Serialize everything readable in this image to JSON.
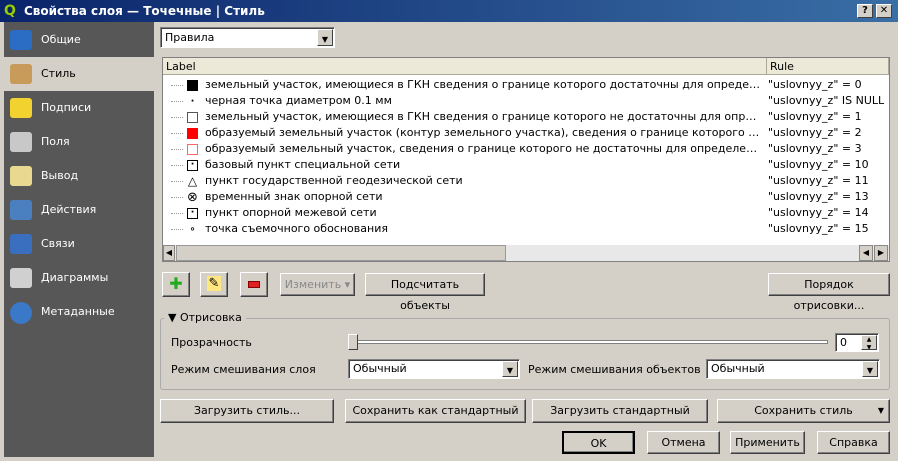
{
  "window": {
    "title": "Свойства слоя — Точечные | Стиль",
    "help_btn": "?",
    "close_btn": "✕"
  },
  "sidebar": {
    "items": [
      {
        "label": "Общие",
        "icon": "tools-icon",
        "color": "#2b6cc4"
      },
      {
        "label": "Стиль",
        "icon": "paintbrush-icon",
        "color": "#c89b5a"
      },
      {
        "label": "Подписи",
        "icon": "abc-label-icon",
        "color": "#f2d22e"
      },
      {
        "label": "Поля",
        "icon": "table-icon",
        "color": "#c8c8c8"
      },
      {
        "label": "Вывод",
        "icon": "speech-bubble-icon",
        "color": "#e8d890"
      },
      {
        "label": "Действия",
        "icon": "gear-play-icon",
        "color": "#4a7fc0"
      },
      {
        "label": "Связи",
        "icon": "arrow-left-icon",
        "color": "#3a6fc0"
      },
      {
        "label": "Диаграммы",
        "icon": "chart-icon",
        "color": "#d0d0d0"
      },
      {
        "label": "Метаданные",
        "icon": "info-icon",
        "color": "#3a78c8"
      }
    ],
    "selected": 1
  },
  "renderer": {
    "value": "Правила"
  },
  "tree": {
    "headers": [
      "Label",
      "Rule"
    ],
    "rows": [
      {
        "symbol": "filled-square",
        "color": "#000000",
        "label": "земельный участок, имеющиеся в ГКН сведения о границе которого достаточны для определения ее пол...",
        "rule": "\"uslovnyy_z\" = 0"
      },
      {
        "symbol": "dot",
        "color": "#000000",
        "label": "черная точка диаметром 0.1 мм",
        "rule": "\"uslovnyy_z\" IS NULL"
      },
      {
        "symbol": "empty-square",
        "color": "#000000",
        "label": "земельный участок, имеющиеся в ГКН сведения о границе которого не достаточны для определения ее п...",
        "rule": "\"uslovnyy_z\" = 1"
      },
      {
        "symbol": "filled-square",
        "color": "#ff0000",
        "label": "образуемый земельный участок (контур земельного участка), сведения о границе которого достаточны ...",
        "rule": "\"uslovnyy_z\" = 2"
      },
      {
        "symbol": "empty-square",
        "color": "#ff0000",
        "label": "образуемый земельный участок, сведения о границе которого не достаточны для определения ее полож...",
        "rule": "\"uslovnyy_z\" = 3"
      },
      {
        "symbol": "square-dot",
        "color": "#000000",
        "label": "базовый пункт специальной сети",
        "rule": "\"uslovnyy_z\" = 10"
      },
      {
        "symbol": "triangle",
        "color": "#000000",
        "label": "пункт государственной геодезической сети",
        "rule": "\"uslovnyy_z\" = 11"
      },
      {
        "symbol": "circle-x",
        "color": "#000000",
        "label": "временный знак опорной сети",
        "rule": "\"uslovnyy_z\" = 13"
      },
      {
        "symbol": "square-dot",
        "color": "#000000",
        "label": "пункт опорной межевой сети",
        "rule": "\"uslovnyy_z\" = 14"
      },
      {
        "symbol": "small-circle",
        "color": "#000000",
        "label": "точка съемочного обоснования",
        "rule": "\"uslovnyy_z\"  = 15"
      }
    ]
  },
  "toolbar": {
    "add": "add-rule-icon",
    "edit": "edit-rule-icon",
    "remove": "remove-rule-icon",
    "modify": "Изменить",
    "count": "Подсчитать объекты",
    "order": "Порядок отрисовки..."
  },
  "render_group": {
    "title": "Отрисовка",
    "transparency_label": "Прозрачность",
    "transparency": "0",
    "layer_blend_label": "Режим смешивания слоя",
    "layer_blend": "Обычный",
    "feature_blend_label": "Режим смешивания объектов",
    "feature_blend": "Обычный"
  },
  "style_buttons": {
    "load": "Загрузить стиль...",
    "save_default": "Сохранить как стандартный",
    "load_default": "Загрузить стандартный",
    "save": "Сохранить стиль"
  },
  "dialog": {
    "ok": "OK",
    "cancel": "Отмена",
    "apply": "Применить",
    "help": "Справка"
  }
}
